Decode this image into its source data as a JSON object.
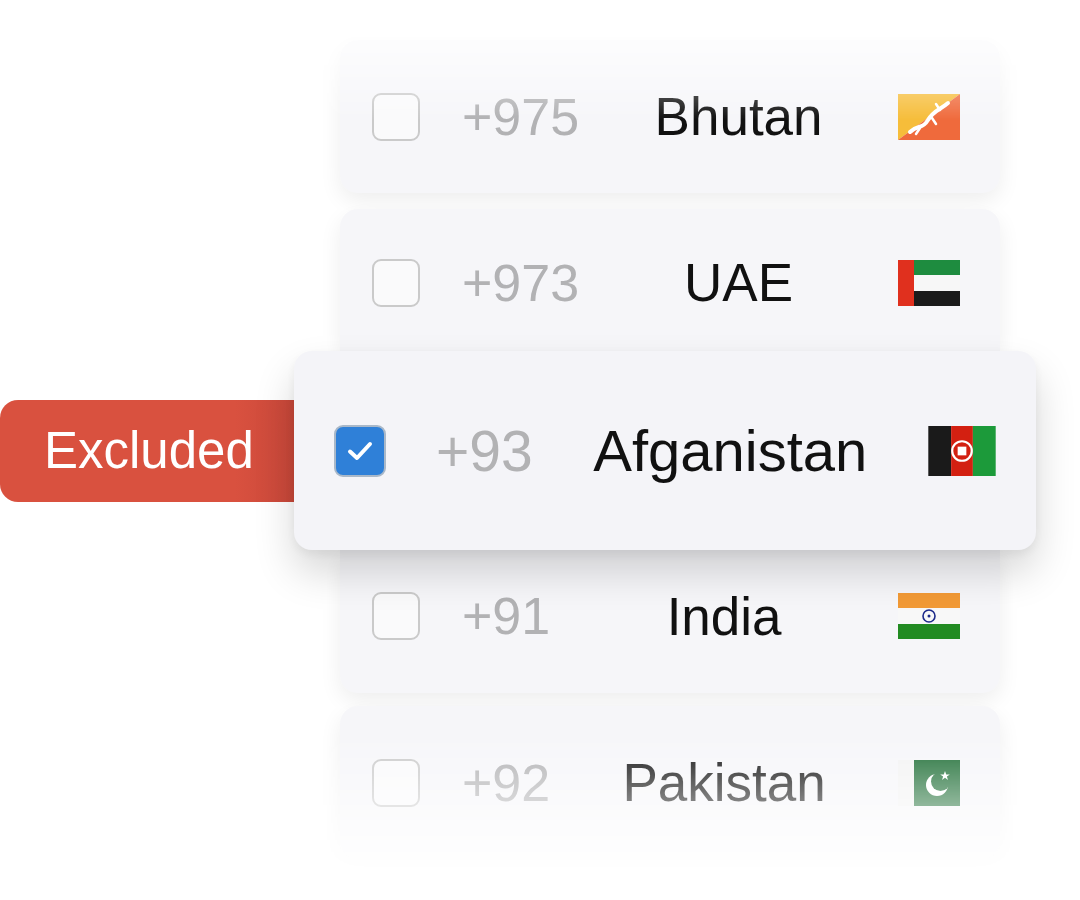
{
  "rows": [
    {
      "code": "+975",
      "name": "Bhutan",
      "checked": false,
      "selected": false
    },
    {
      "code": "+973",
      "name": "UAE",
      "checked": false,
      "selected": false
    },
    {
      "code": "+93",
      "name": "Afganistan",
      "checked": true,
      "selected": true,
      "badge": "Excluded"
    },
    {
      "code": "+91",
      "name": "India",
      "checked": false,
      "selected": false
    },
    {
      "code": "+92",
      "name": "Pakistan",
      "checked": false,
      "selected": false
    }
  ]
}
